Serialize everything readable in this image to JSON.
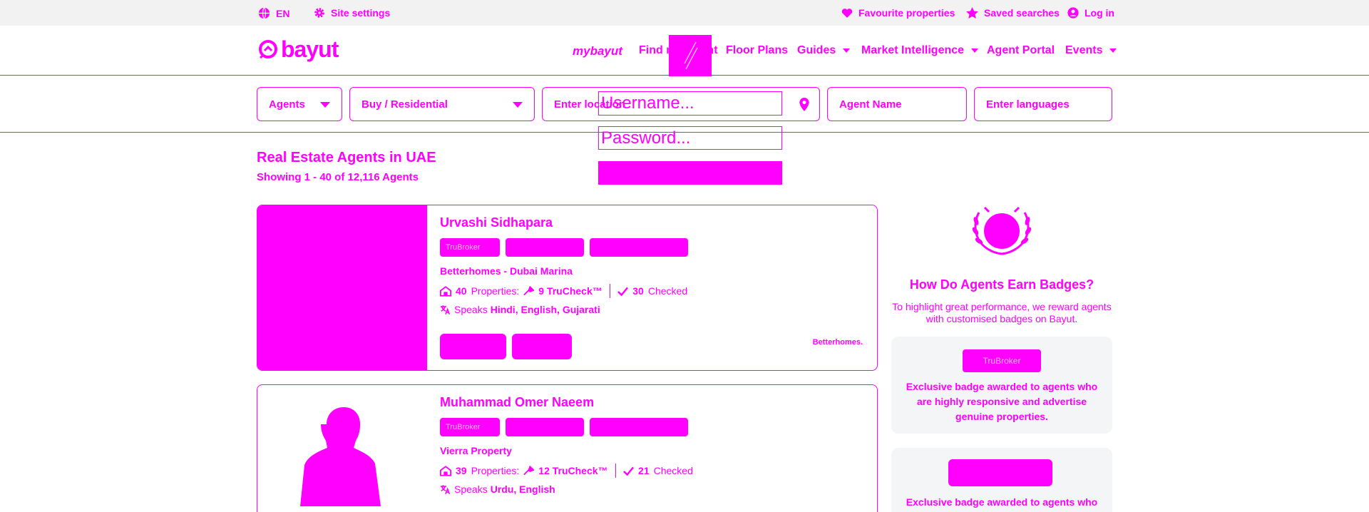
{
  "colors": {
    "accent": "#ff00ff",
    "topbar_bg": "#f2f2f2",
    "panel_bg": "#f4f5f7"
  },
  "topbar": {
    "language": "EN",
    "site_settings": "Site settings",
    "favourites": "Favourite properties",
    "saved_searches": "Saved searches",
    "login": "Log in"
  },
  "header": {
    "logo": "bayut",
    "nav": {
      "mybayut": "mybayut",
      "find_my_agent": "Find my Agent",
      "floor_plans": "Floor Plans",
      "guides": "Guides",
      "market_intelligence": "Market Intelligence",
      "agent_portal": "Agent Portal",
      "events": "Events"
    }
  },
  "search": {
    "type_value": "Agents",
    "purpose_value": "Buy / Residential",
    "location_placeholder": "Enter location",
    "agent_name_placeholder": "Agent Name",
    "languages_placeholder": "Enter languages"
  },
  "login_overlay": {
    "username_placeholder": "Username...",
    "password_placeholder": "Password..."
  },
  "results": {
    "title": "Real Estate Agents in UAE",
    "count_text": "Showing 1 - 40 of 12,116 Agents"
  },
  "agents": [
    {
      "name": "Urvashi Sidhapara",
      "badge": "TruBroker",
      "agency": "Betterhomes - Dubai Marina",
      "properties_count": "40",
      "properties_label": "Properties:",
      "truchecks": "9 TruCheck™",
      "checked_count": "30",
      "checked_label": "Checked",
      "speaks_label": "Speaks",
      "languages": "Hindi, English, Gujarati",
      "agency_logo": "Betterhomes."
    },
    {
      "name": "Muhammad Omer Naeem",
      "badge": "TruBroker",
      "agency": "Vierra Property",
      "properties_count": "39",
      "properties_label": "Properties:",
      "truchecks": "12 TruCheck™",
      "checked_count": "21",
      "checked_label": "Checked",
      "speaks_label": "Speaks",
      "languages": "Urdu, English"
    }
  ],
  "sidebar": {
    "title": "How Do Agents Earn Badges?",
    "description": "To highlight great performance, we reward agents with customised badges on Bayut.",
    "badges": [
      {
        "label": "TruBroker",
        "text": "Exclusive badge awarded to agents who are highly responsive and advertise genuine properties."
      },
      {
        "label": "",
        "text": "Exclusive badge awarded to agents who"
      }
    ]
  }
}
